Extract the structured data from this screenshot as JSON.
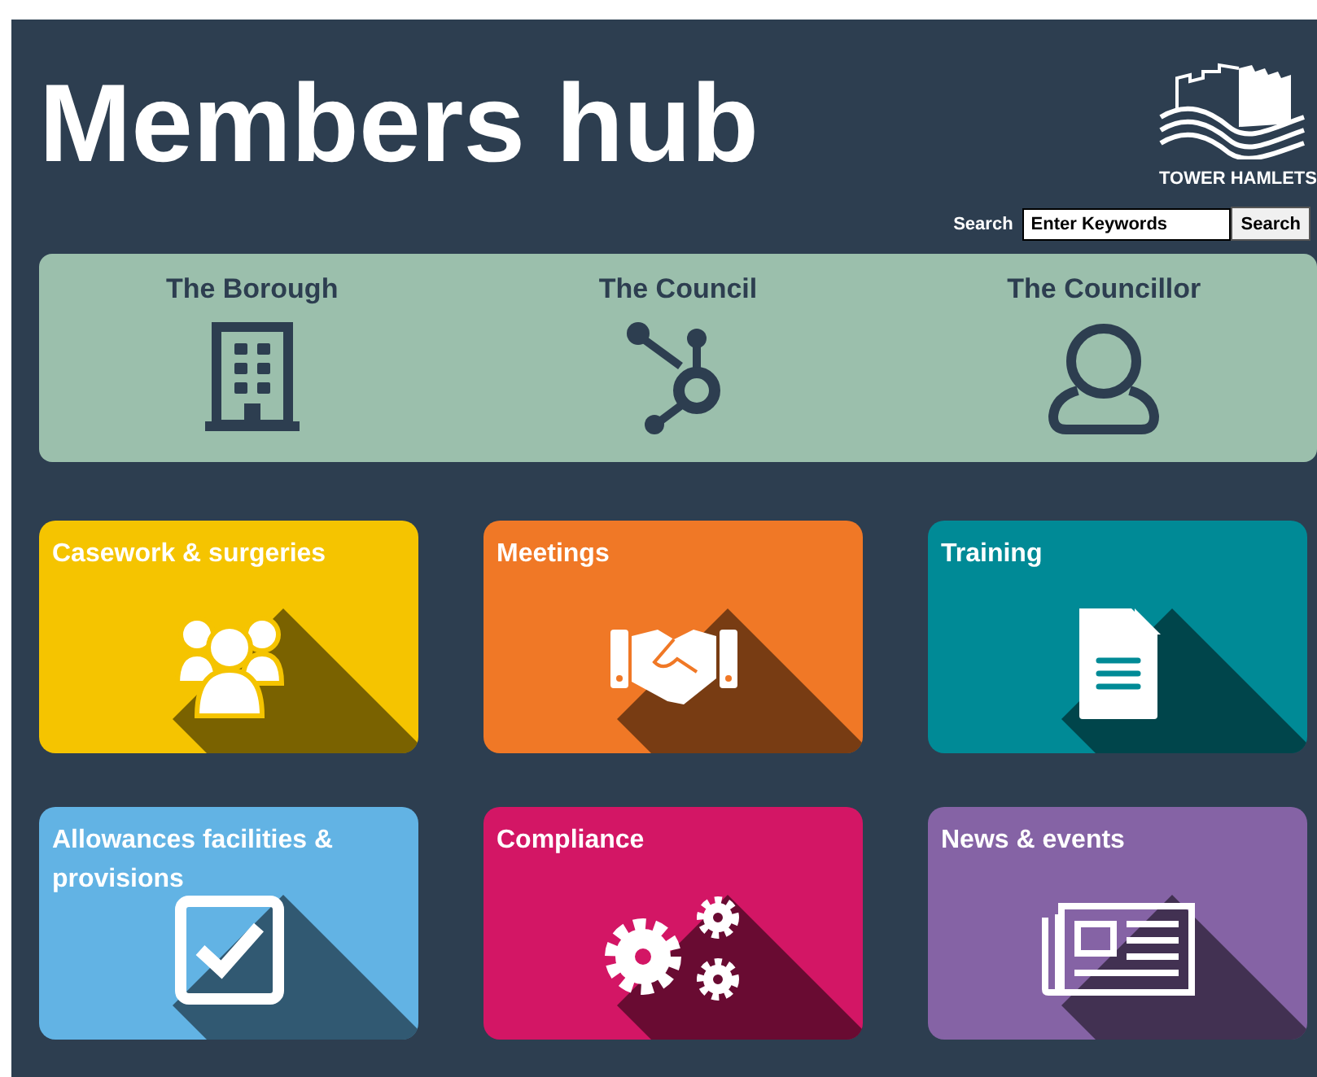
{
  "header": {
    "title": "Members hub",
    "logo_text": "TOWER HAMLETS"
  },
  "search": {
    "label": "Search",
    "value": "Enter Keywords",
    "button": "Search"
  },
  "sections": [
    {
      "label": "The Borough"
    },
    {
      "label": "The Council"
    },
    {
      "label": "The Councillor"
    }
  ],
  "tiles": [
    {
      "label": "Casework & surgeries",
      "color": "#f5c400"
    },
    {
      "label": "Meetings",
      "color": "#f07826"
    },
    {
      "label": "Training",
      "color": "#008a96"
    },
    {
      "label": "Allowances facilities & provisions",
      "color": "#62b3e4"
    },
    {
      "label": "Compliance",
      "color": "#d31665"
    },
    {
      "label": "News & events",
      "color": "#8563a5"
    }
  ]
}
